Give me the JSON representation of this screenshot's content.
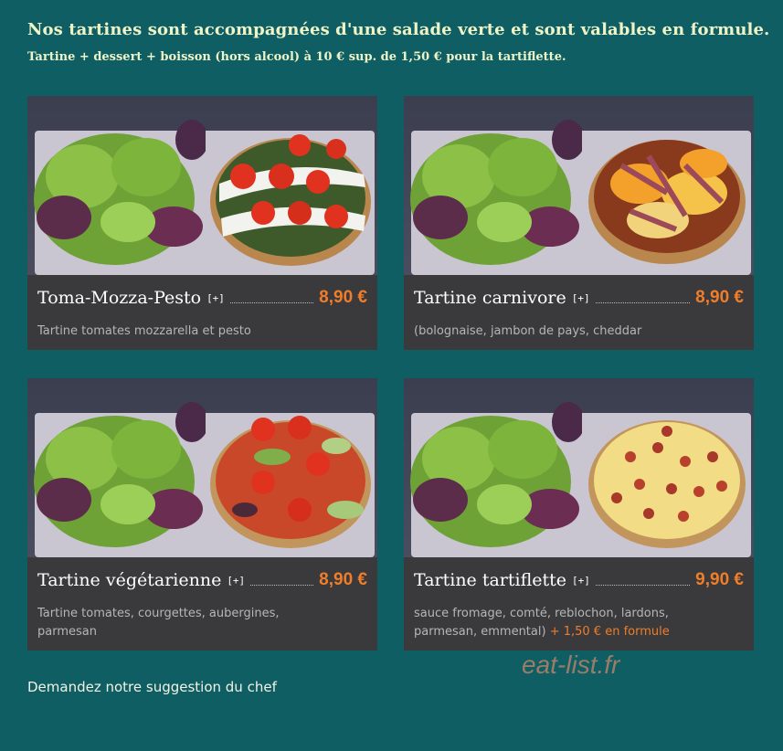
{
  "header": {
    "headline": "Nos tartines sont accompagnées d'une salade verte et sont valables en formule.",
    "subline": "Tartine + dessert + boisson (hors alcool) à 10 € sup. de 1,50 € pour la tartiflette."
  },
  "items": [
    {
      "name": "Toma-Mozza-Pesto",
      "plus": "[+]",
      "price": "8,90 €",
      "description": "Tartine tomates mozzarella et pesto",
      "description_line2": "",
      "extra": "",
      "image": "tartine-tomato-mozzarella-pesto-image"
    },
    {
      "name": "Tartine carnivore",
      "plus": "[+]",
      "price": "8,90 €",
      "description": "(bolognaise, jambon de pays, cheddar",
      "description_line2": "",
      "extra": "",
      "image": "tartine-carnivore-image"
    },
    {
      "name": "Tartine végétarienne",
      "plus": "[+]",
      "price": "8,90 €",
      "description": "Tartine tomates, courgettes, aubergines,",
      "description_line2": "parmesan",
      "extra": "",
      "image": "tartine-vegetarienne-image"
    },
    {
      "name": "Tartine tartiflette",
      "plus": "[+]",
      "price": "9,90 €",
      "description": "sauce fromage, comté, reblochon, lardons,",
      "description_line2": "parmesan, emmental)",
      "extra": "+ 1,50 € en formule",
      "image": "tartine-tartiflette-image"
    }
  ],
  "footer": {
    "text": "Demandez notre suggestion du chef"
  },
  "watermark": "eat-list.fr",
  "colors": {
    "background": "#0e5e63",
    "price": "#ef7d2a",
    "card": "#3a3a3c",
    "headline": "#eef4c8"
  }
}
